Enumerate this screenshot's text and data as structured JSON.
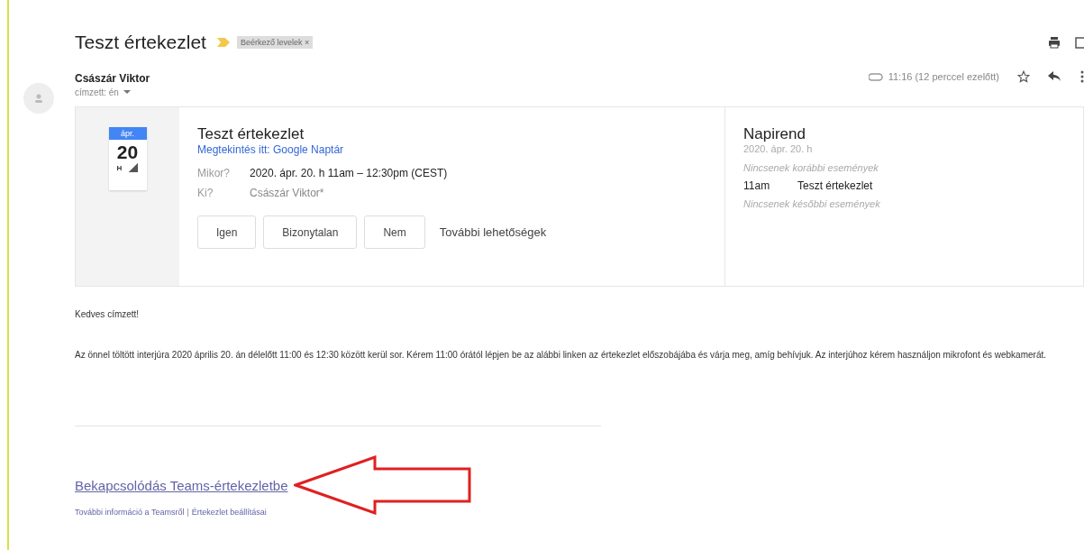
{
  "subject": "Teszt értekezlet",
  "label": {
    "text": "Beérkező levelek",
    "close": "×"
  },
  "sender": {
    "name": "Császár Viktor",
    "to": "címzett: én",
    "time": "11:16 (12 perccel ezelőtt)",
    "starred": false
  },
  "invite": {
    "month": "ápr.",
    "day": "20",
    "weekday": "H",
    "title": "Teszt értekezlet",
    "calendar_link": "Megtekintés itt: Google Naptár",
    "details": [
      {
        "label": "Mikor?",
        "value": "2020. ápr. 20. h 11am – 12:30pm (CEST)",
        "kind": "strong"
      },
      {
        "label": "Ki?",
        "value": "Császár Viktor*",
        "kind": "muted"
      }
    ],
    "buttons": [
      "Igen",
      "Bizonytalan",
      "Nem"
    ],
    "more": "További lehetőségek"
  },
  "agenda": {
    "title": "Napirend",
    "date": "2020. ápr. 20. h",
    "items": [
      {
        "kind": "note",
        "text": "Nincsenek korábbi események"
      },
      {
        "kind": "event",
        "time": "11am",
        "text": "Teszt értekezlet"
      },
      {
        "kind": "note",
        "text": "Nincsenek későbbi események"
      }
    ]
  },
  "body": {
    "greeting": "Kedves címzett!",
    "paragraph": "Az önnel töltött interjúra 2020 április 20. án délelőtt 11:00 és 12:30 között kerül sor. Kérem 11:00 órától lépjen be az alábbi linken az értekezlet előszobájába és várja meg, amíg behívjuk. Az interjúhoz kérem használjon mikrofont és webkamerát."
  },
  "teams": {
    "join": "Bekapcsolódás Teams-értekezletbe",
    "info": "További információ a Teamsről",
    "separator": "|",
    "settings": "Értekezlet beállításai"
  }
}
